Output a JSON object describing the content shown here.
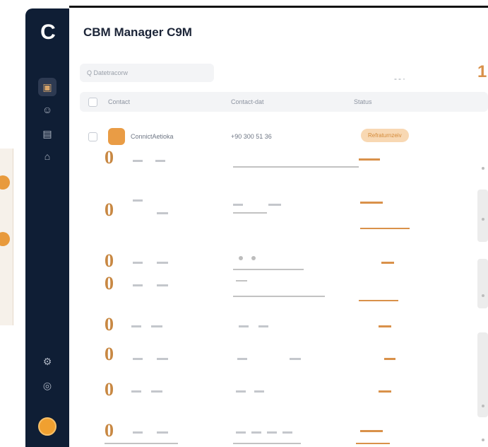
{
  "app": {
    "title": "CBM Manager C9M",
    "logo_text": "C"
  },
  "search": {
    "placeholder": "Q  Datetracorw"
  },
  "table": {
    "headers": [
      "Contact",
      "Contact-dat",
      "Status",
      ""
    ],
    "rows": [
      {
        "name": "ConnictAetioka",
        "phone": "+90 300 51 36",
        "status": "Refraturnzeiv"
      }
    ]
  },
  "overlay_digits": {
    "big_number": "1",
    "top_dash": "--·",
    "row_zeros": [
      "0",
      "0",
      "0",
      "0",
      "0",
      "0",
      "0",
      "0"
    ]
  },
  "colors": {
    "sidebar": "#0f1e35",
    "accent": "#d9914a",
    "pill_bg": "#f8d8b3"
  },
  "icons": {
    "sidebar": [
      "logo-c",
      "dashboard-icon",
      "users-icon",
      "calendar-icon",
      "house-icon",
      "settings-icon",
      "info-icon",
      "user-avatar"
    ]
  }
}
